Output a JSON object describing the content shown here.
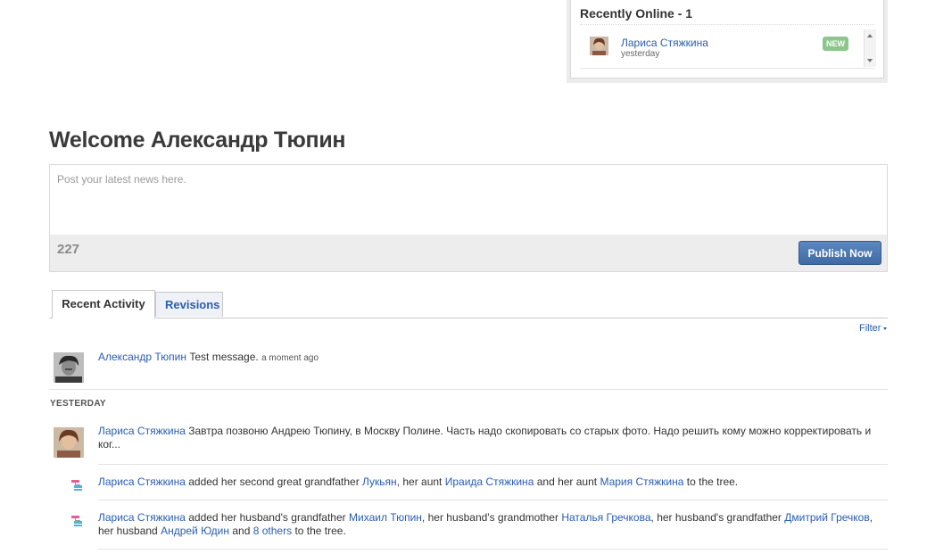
{
  "recently_online": {
    "title": "Recently Online - 1",
    "items": [
      {
        "name": "Лариса Стяжкина",
        "time": "yesterday",
        "badge": "NEW"
      }
    ]
  },
  "welcome": {
    "text": "Welcome Александр Тюпин"
  },
  "composer": {
    "placeholder": "Post your latest news here.",
    "char_count": "227",
    "publish_label": "Publish Now"
  },
  "tabs": [
    {
      "label": "Recent Activity",
      "active": true
    },
    {
      "label": "Revisions",
      "active": false
    }
  ],
  "filter": {
    "label": "Filter"
  },
  "activity": {
    "item1": {
      "author": "Александр Тюпин",
      "message": "Test message.",
      "time": "a moment ago"
    },
    "section_yesterday": "YESTERDAY",
    "item2": {
      "author": "Лариса Стяжкина",
      "message": "Завтра позвоню Андрею Тюпину, в Москву Полине. Часть надо скопировать со старых фото. Надо решить кому можно корректировать и ког..."
    },
    "item3": {
      "author": "Лариса Стяжкина",
      "t1": "added her second great grandfather",
      "p1": "Лукьян",
      "t2": ", her aunt",
      "p2": "Ираида Стяжкина",
      "t3": "and her aunt",
      "p3": "Мария Стяжкина",
      "t4": "to the tree."
    },
    "item4": {
      "author": "Лариса Стяжкина",
      "t1": "added her husband's grandfather",
      "p1": "Михаил Тюпин",
      "t2": ", her husband's grandmother",
      "p2": "Наталья Гречкова",
      "t3": ", her husband's grandfather",
      "p3": "Дмитрий Гречков",
      "t4": ", her husband",
      "p4": "Андрей Юдин",
      "t5": "and",
      "p5": "8 others",
      "t6": "to the tree."
    }
  },
  "colors": {
    "link": "#2a5db0",
    "publish": "#4a74ad",
    "badge": "#8cc68c"
  },
  "icons": {
    "tree_icon": "family-tree-icon"
  }
}
